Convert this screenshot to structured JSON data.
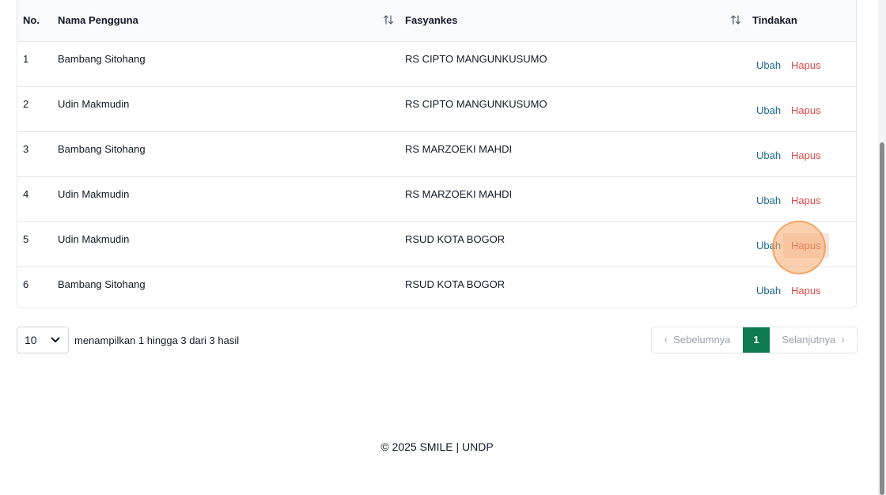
{
  "table": {
    "headers": {
      "no": "No.",
      "user": "Nama Pengguna",
      "facility": "Fasyankes",
      "action": "Tindakan"
    },
    "rows": [
      {
        "no": "1",
        "user": "Bambang Sitohang",
        "facility": "RS CIPTO MANGUNKUSUMO"
      },
      {
        "no": "2",
        "user": "Udin Makmudin",
        "facility": "RS CIPTO MANGUNKUSUMO"
      },
      {
        "no": "3",
        "user": "Bambang Sitohang",
        "facility": "RS MARZOEKI MAHDI"
      },
      {
        "no": "4",
        "user": "Udin Makmudin",
        "facility": "RS MARZOEKI MAHDI"
      },
      {
        "no": "5",
        "user": "Udin Makmudin",
        "facility": "RSUD KOTA BOGOR"
      },
      {
        "no": "6",
        "user": "Bambang Sitohang",
        "facility": "RSUD KOTA BOGOR"
      }
    ],
    "edit_label": "Ubah",
    "delete_label": "Hapus"
  },
  "pagination": {
    "page_size": "10",
    "info": "menampilkan 1 hingga 3 dari 3 hasil",
    "prev_label": "Sebelumnya",
    "current_page": "1",
    "next_label": "Selanjutnya"
  },
  "footer": {
    "text": "© 2025 SMILE | UNDP"
  },
  "colors": {
    "edit": "#1e6a8d",
    "delete": "#d94a4a",
    "active_page": "#0f7a4f"
  }
}
